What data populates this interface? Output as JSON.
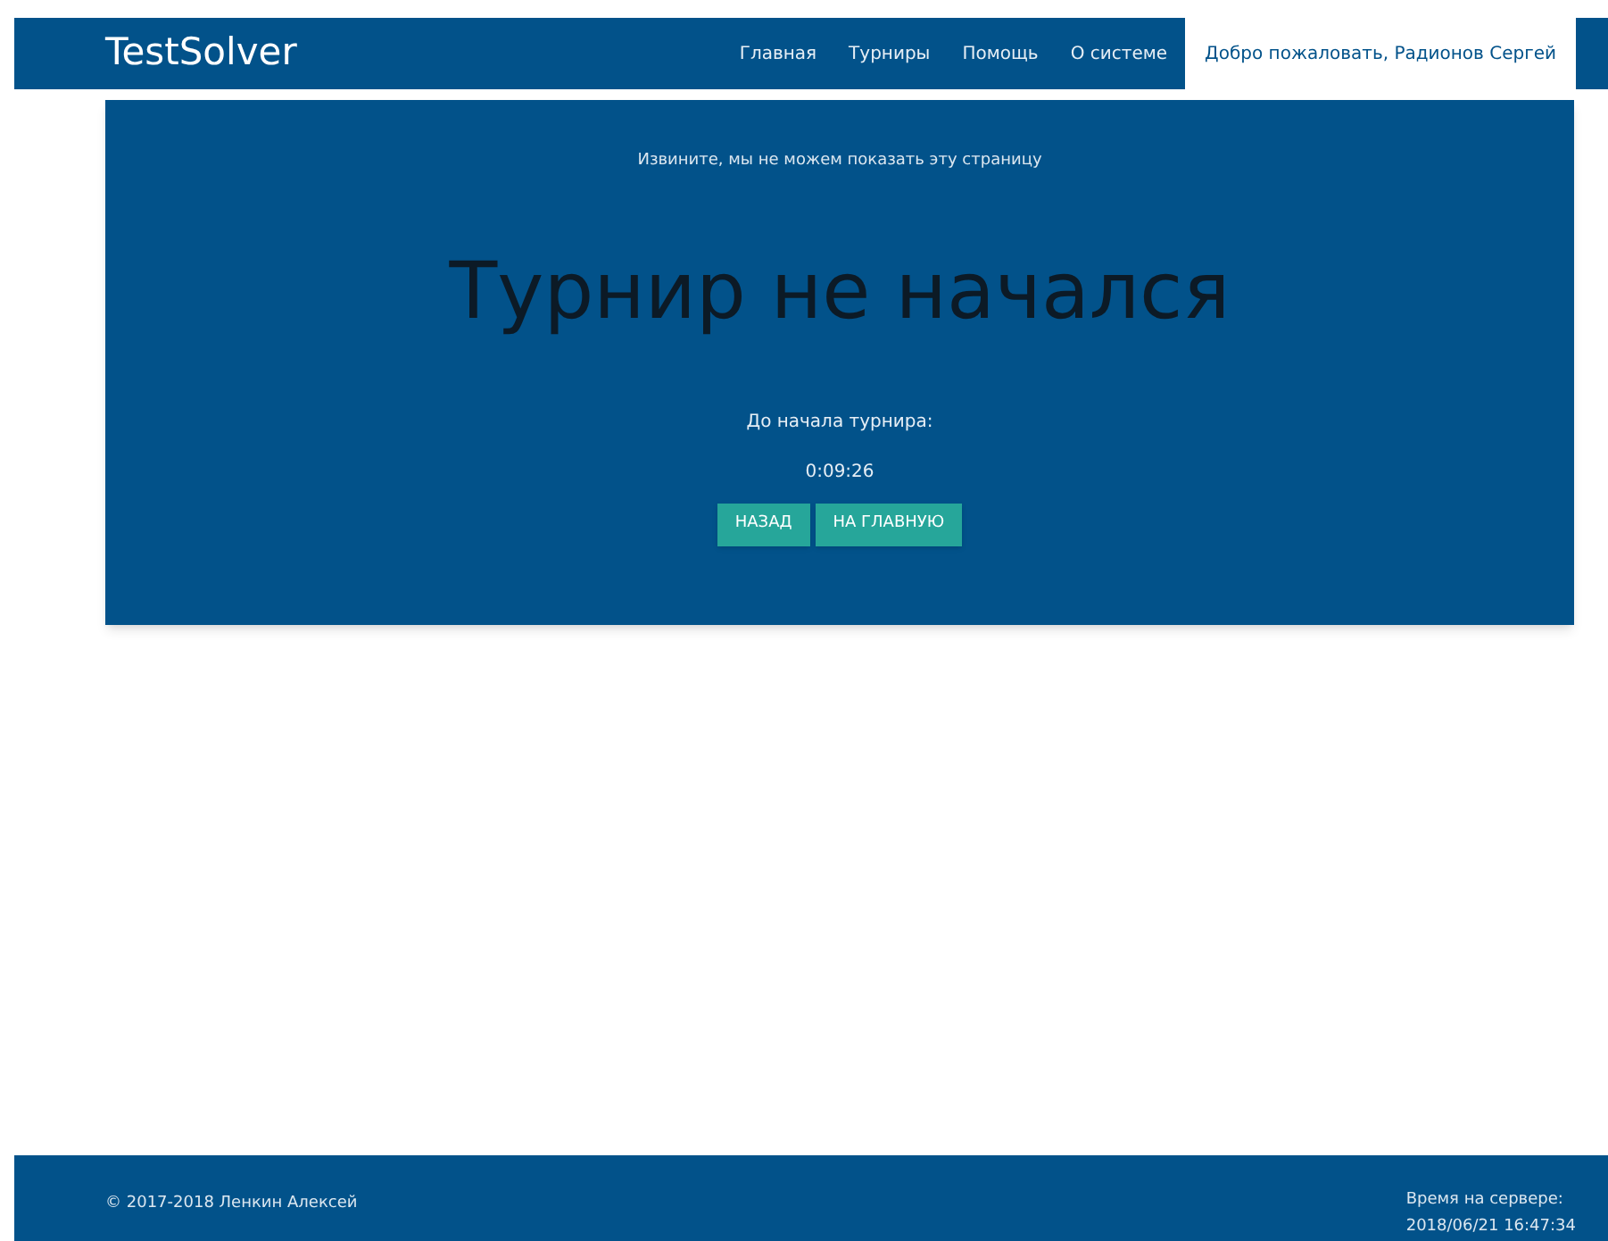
{
  "navbar": {
    "brand": "TestSolver",
    "links": [
      {
        "label": "Главная",
        "selected": false
      },
      {
        "label": "Турниры",
        "selected": false
      },
      {
        "label": "Помощь",
        "selected": false
      },
      {
        "label": "О системе",
        "selected": false
      }
    ],
    "user": "Добро пожаловать, Радионов Сергей"
  },
  "panel": {
    "notice": "Извините, мы не можем показать эту страницу",
    "heading": "Турнир не начался",
    "countdown_label": "До начала турнира:",
    "countdown": "0:09:26",
    "buttons": [
      "НАЗАД",
      "НА ГЛАВНУЮ"
    ]
  },
  "footer": {
    "copyright": "© 2017-2018 Ленкин Алексей",
    "server_time_label": "Время на сервере:",
    "server_time": "2018/06/21 16:47:34"
  }
}
